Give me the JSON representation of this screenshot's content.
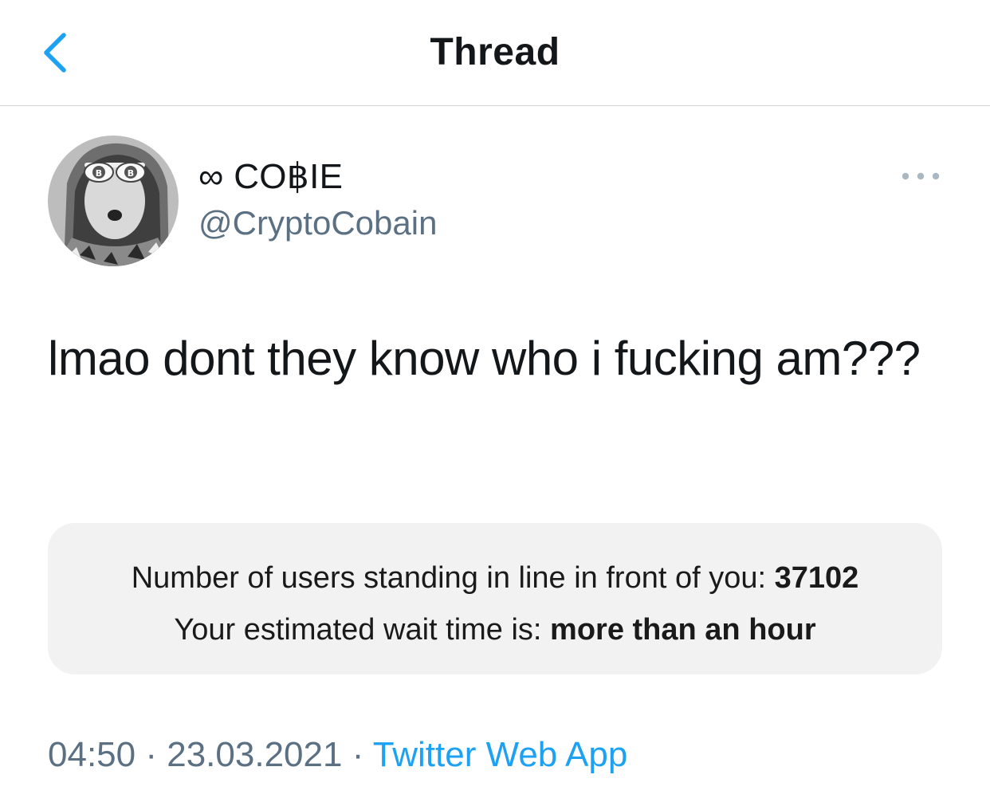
{
  "header": {
    "title": "Thread",
    "back_icon": "chevron-left-icon",
    "accent_color": "#1da1f2"
  },
  "tweet": {
    "author": {
      "display_name": "∞ CO฿IE",
      "handle": "@CryptoCobain",
      "avatar_icon": "avatar"
    },
    "more_icon": "more-horizontal-icon",
    "text": "lmao dont they know who i fucking am???",
    "media": {
      "line1_label": "Number of users standing in line in front of you: ",
      "line1_value": "37102",
      "line2_label": "Your estimated wait time is: ",
      "line2_value": "more than an hour"
    },
    "time": "04:50",
    "separator": "·",
    "date": "23.03.2021",
    "source": "Twitter Web App"
  }
}
